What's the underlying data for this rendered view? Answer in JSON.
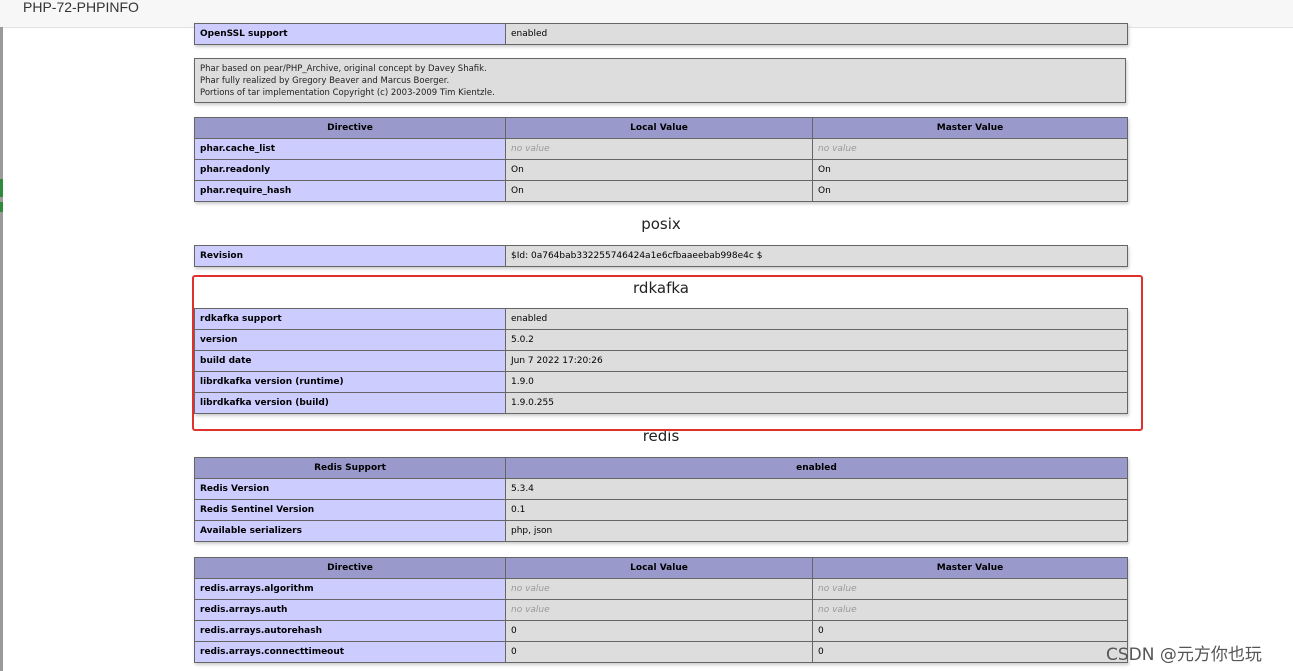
{
  "window": {
    "title": "PHP-72-PHPINFO"
  },
  "openssl_row": {
    "label": "OpenSSL support",
    "value": "enabled"
  },
  "phar_info": [
    "Phar based on pear/PHP_Archive, original concept by Davey Shafik.",
    "Phar fully realized by Gregory Beaver and Marcus Boerger.",
    "Portions of tar implementation Copyright (c) 2003-2009 Tim Kientzle."
  ],
  "phar_directives": {
    "headers": [
      "Directive",
      "Local Value",
      "Master Value"
    ],
    "rows": [
      {
        "name": "phar.cache_list",
        "local": "no value",
        "master": "no value"
      },
      {
        "name": "phar.readonly",
        "local": "On",
        "master": "On"
      },
      {
        "name": "phar.require_hash",
        "local": "On",
        "master": "On"
      }
    ]
  },
  "posix": {
    "heading": "posix",
    "revision_label": "Revision",
    "revision_value": "$Id: 0a764bab332255746424a1e6cfbaaeebab998e4c $"
  },
  "rdkafka": {
    "heading": "rdkafka",
    "rows": [
      {
        "label": "rdkafka support",
        "value": "enabled"
      },
      {
        "label": "version",
        "value": "5.0.2"
      },
      {
        "label": "build date",
        "value": "Jun 7 2022 17:20:26"
      },
      {
        "label": "librdkafka version (runtime)",
        "value": "1.9.0"
      },
      {
        "label": "librdkafka version (build)",
        "value": "1.9.0.255"
      }
    ]
  },
  "redis": {
    "heading": "redis",
    "support_header": {
      "label": "Redis Support",
      "value": "enabled"
    },
    "rows": [
      {
        "label": "Redis Version",
        "value": "5.3.4"
      },
      {
        "label": "Redis Sentinel Version",
        "value": "0.1"
      },
      {
        "label": "Available serializers",
        "value": "php, json"
      }
    ],
    "directives": {
      "headers": [
        "Directive",
        "Local Value",
        "Master Value"
      ],
      "rows": [
        {
          "name": "redis.arrays.algorithm",
          "local": "no value",
          "master": "no value"
        },
        {
          "name": "redis.arrays.auth",
          "local": "no value",
          "master": "no value"
        },
        {
          "name": "redis.arrays.autorehash",
          "local": "0",
          "master": "0"
        },
        {
          "name": "redis.arrays.connecttimeout",
          "local": "0",
          "master": "0"
        }
      ]
    }
  },
  "watermark": "CSDN @元方你也玩"
}
